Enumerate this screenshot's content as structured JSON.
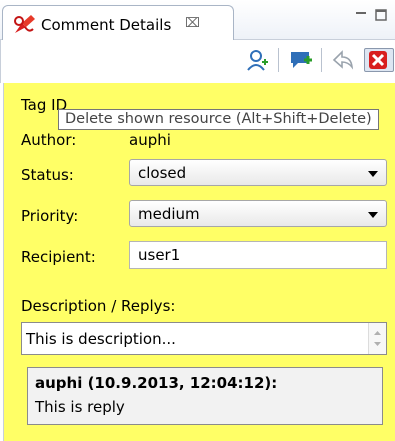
{
  "tab": {
    "title": "Comment Details",
    "close_symbol": "⌧"
  },
  "tooltip": "Delete shown resource (Alt+Shift+Delete)",
  "form": {
    "tag_label": "Tag ID",
    "author_label": "Author:",
    "author_value": "auphi",
    "status_label": "Status:",
    "status_value": "closed",
    "priority_label": "Priority:",
    "priority_value": "medium",
    "recipient_label": "Recipient:",
    "recipient_value": "user1",
    "desc_label": "Description / Replys:",
    "desc_value": "This is description..."
  },
  "reply": {
    "header": "auphi (10.9.2013, 12:04:12):",
    "body": "This is reply"
  },
  "toolbar": {
    "icons": [
      "assign-reviewer-icon",
      "add-comment-icon",
      "reply-icon",
      "delete-icon"
    ]
  },
  "colors": {
    "panel": "#ffff66",
    "accent_red": "#d81e1e",
    "accent_blue": "#2f6fb8"
  }
}
